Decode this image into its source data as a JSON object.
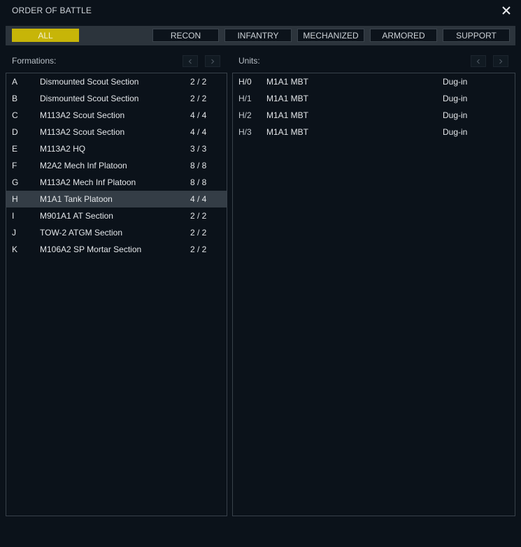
{
  "window": {
    "title": "ORDER OF BATTLE",
    "close_icon": "close-icon"
  },
  "filters": [
    "ALL",
    "RECON",
    "INFANTRY",
    "MECHANIZED",
    "ARMORED",
    "SUPPORT"
  ],
  "active_filter": "ALL",
  "formations": {
    "label": "Formations:",
    "items": [
      {
        "id": "A",
        "name": "Dismounted Scout Section",
        "count": "2 / 2"
      },
      {
        "id": "B",
        "name": "Dismounted Scout Section",
        "count": "2 / 2"
      },
      {
        "id": "C",
        "name": "M113A2 Scout Section",
        "count": "4 / 4"
      },
      {
        "id": "D",
        "name": "M113A2 Scout Section",
        "count": "4 / 4"
      },
      {
        "id": "E",
        "name": "M113A2 HQ",
        "count": "3 / 3"
      },
      {
        "id": "F",
        "name": "M2A2 Mech Inf Platoon",
        "count": "8 / 8"
      },
      {
        "id": "G",
        "name": "M113A2 Mech Inf Platoon",
        "count": "8 / 8"
      },
      {
        "id": "H",
        "name": "M1A1 Tank Platoon",
        "count": "4 / 4"
      },
      {
        "id": "I",
        "name": "M901A1 AT Section",
        "count": "2 / 2"
      },
      {
        "id": "J",
        "name": "TOW-2 ATGM Section",
        "count": "2 / 2"
      },
      {
        "id": "K",
        "name": "M106A2 SP Mortar Section",
        "count": "2 / 2"
      }
    ],
    "selected_id": "H"
  },
  "units": {
    "label": "Units:",
    "items": [
      {
        "id": "H/0",
        "name": "M1A1 MBT",
        "status": "Dug-in"
      },
      {
        "id": "H/1",
        "name": "M1A1 MBT",
        "status": "Dug-in"
      },
      {
        "id": "H/2",
        "name": "M1A1 MBT",
        "status": "Dug-in"
      },
      {
        "id": "H/3",
        "name": "M1A1 MBT",
        "status": "Dug-in"
      }
    ]
  },
  "colors": {
    "accent": "#c7b508",
    "background": "#0b121a",
    "selected_row": "#343d46"
  }
}
